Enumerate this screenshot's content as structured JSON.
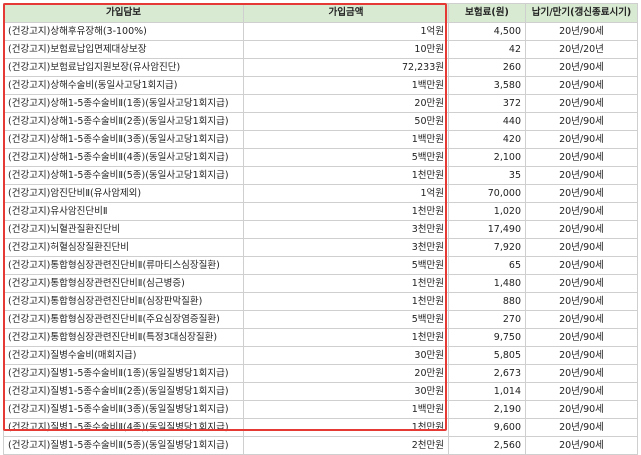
{
  "table": {
    "headers": [
      "가입담보",
      "가입금액",
      "보험료(원)",
      "납기/만기(갱신종료시기)"
    ],
    "rows": [
      [
        "(건강고지)상해후유장해(3-100%)",
        "1억원",
        "4,500",
        "20년/90세"
      ],
      [
        "(건강고지)보험료납입면제대상보장",
        "10만원",
        "42",
        "20년/20년"
      ],
      [
        "(건강고지)보험료납입지원보장(유사암진단)",
        "72,233원",
        "260",
        "20년/90세"
      ],
      [
        "(건강고지)상해수술비(동일사고당1회지급)",
        "1백만원",
        "3,580",
        "20년/90세"
      ],
      [
        "(건강고지)상해1-5종수술비Ⅱ(1종)(동일사고당1회지급)",
        "20만원",
        "372",
        "20년/90세"
      ],
      [
        "(건강고지)상해1-5종수술비Ⅱ(2종)(동일사고당1회지급)",
        "50만원",
        "440",
        "20년/90세"
      ],
      [
        "(건강고지)상해1-5종수술비Ⅱ(3종)(동일사고당1회지급)",
        "1백만원",
        "420",
        "20년/90세"
      ],
      [
        "(건강고지)상해1-5종수술비Ⅱ(4종)(동일사고당1회지급)",
        "5백만원",
        "2,100",
        "20년/90세"
      ],
      [
        "(건강고지)상해1-5종수술비Ⅱ(5종)(동일사고당1회지급)",
        "1천만원",
        "35",
        "20년/90세"
      ],
      [
        "(건강고지)암진단비Ⅱ(유사암제외)",
        "1억원",
        "70,000",
        "20년/90세"
      ],
      [
        "(건강고지)유사암진단비Ⅱ",
        "1천만원",
        "1,020",
        "20년/90세"
      ],
      [
        "(건강고지)뇌혈관질환진단비",
        "3천만원",
        "17,490",
        "20년/90세"
      ],
      [
        "(건강고지)허혈심장질환진단비",
        "3천만원",
        "7,920",
        "20년/90세"
      ],
      [
        "(건강고지)통합형심장관련진단비Ⅱ(류마티스심장질환)",
        "5백만원",
        "65",
        "20년/90세"
      ],
      [
        "(건강고지)통합형심장관련진단비Ⅱ(심근병증)",
        "1천만원",
        "1,480",
        "20년/90세"
      ],
      [
        "(건강고지)통합형심장관련진단비Ⅱ(심장판막질환)",
        "1천만원",
        "880",
        "20년/90세"
      ],
      [
        "(건강고지)통합형심장관련진단비Ⅱ(주요심장염증질환)",
        "5백만원",
        "270",
        "20년/90세"
      ],
      [
        "(건강고지)통합형심장관련진단비Ⅱ(특정3대심장질환)",
        "1천만원",
        "9,750",
        "20년/90세"
      ],
      [
        "(건강고지)질병수술비(매회지급)",
        "30만원",
        "5,805",
        "20년/90세"
      ],
      [
        "(건강고지)질병1-5종수술비Ⅱ(1종)(동일질병당1회지급)",
        "20만원",
        "2,673",
        "20년/90세"
      ],
      [
        "(건강고지)질병1-5종수술비Ⅱ(2종)(동일질병당1회지급)",
        "30만원",
        "1,014",
        "20년/90세"
      ],
      [
        "(건강고지)질병1-5종수술비Ⅱ(3종)(동일질병당1회지급)",
        "1백만원",
        "2,190",
        "20년/90세"
      ],
      [
        "(건강고지)질병1-5종수술비Ⅱ(4종)(동일질병당1회지급)",
        "1천만원",
        "9,600",
        "20년/90세"
      ],
      [
        "(건강고지)질병1-5종수술비Ⅱ(5종)(동일질병당1회지급)",
        "2천만원",
        "2,560",
        "20년/90세"
      ]
    ]
  },
  "colors": {
    "header_bg": "#d9ead3",
    "border": "#cfcfcf",
    "highlight": "#e53935"
  }
}
